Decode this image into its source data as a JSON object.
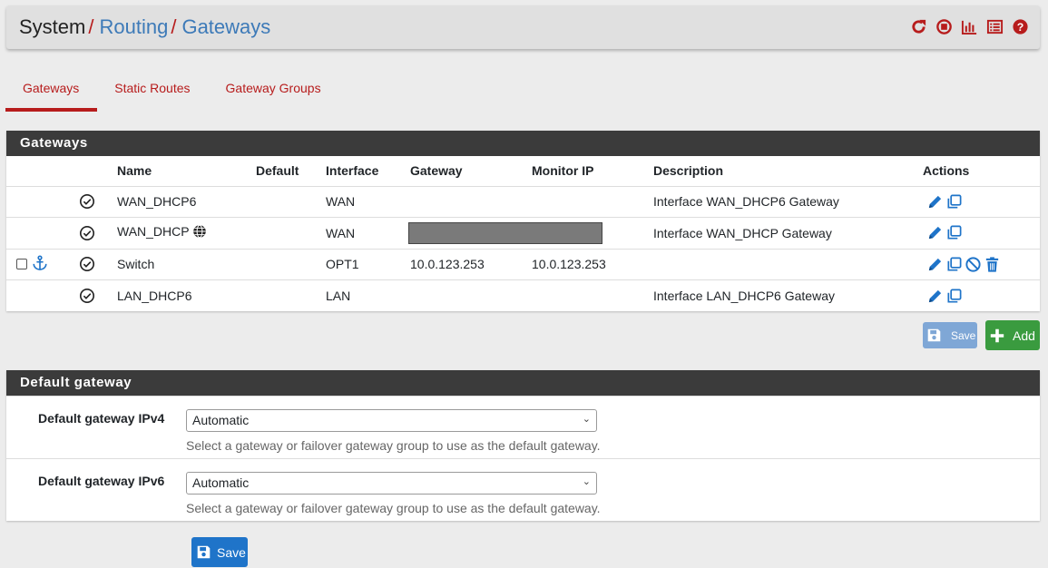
{
  "breadcrumb": {
    "system": "System",
    "sep": "/",
    "routing": "Routing",
    "gateways": "Gateways"
  },
  "header_icons": [
    "reload-icon",
    "stop-icon",
    "chart-icon",
    "list-icon",
    "help-icon"
  ],
  "tabs": [
    {
      "label": "Gateways",
      "active": true
    },
    {
      "label": "Static Routes",
      "active": false
    },
    {
      "label": "Gateway Groups",
      "active": false
    }
  ],
  "gateways_panel": {
    "title": "Gateways",
    "columns": [
      "Name",
      "Default",
      "Interface",
      "Gateway",
      "Monitor IP",
      "Description",
      "Actions"
    ],
    "rows": [
      {
        "name": "WAN_DHCP6",
        "interface": "WAN",
        "gateway": "",
        "monitor": "",
        "description": "Interface WAN_DHCP6 Gateway"
      },
      {
        "name": "WAN_DHCP",
        "interface": "WAN",
        "gateway": "",
        "monitor": "",
        "description": "Interface WAN_DHCP Gateway"
      },
      {
        "name": "Switch",
        "interface": "OPT1",
        "gateway": "10.0.123.253",
        "monitor": "10.0.123.253",
        "description": ""
      },
      {
        "name": "LAN_DHCP6",
        "interface": "LAN",
        "gateway": "",
        "monitor": "",
        "description": "Interface LAN_DHCP6 Gateway"
      }
    ],
    "save_label": "Save",
    "add_label": "Add"
  },
  "default_gateway_panel": {
    "title": "Default gateway",
    "ipv4_label": "Default gateway IPv4",
    "ipv4_value": "Automatic",
    "ipv6_label": "Default gateway IPv6",
    "ipv6_value": "Automatic",
    "help": "Select a gateway or failover gateway group to use as the default gateway."
  },
  "save_button": "Save",
  "colors": {
    "brand_red": "#b71c1c",
    "link_blue": "#3d7ab8",
    "action_blue": "#1f74c9",
    "add_green": "#3a9b3f",
    "panel_header": "#3b3b3b"
  }
}
